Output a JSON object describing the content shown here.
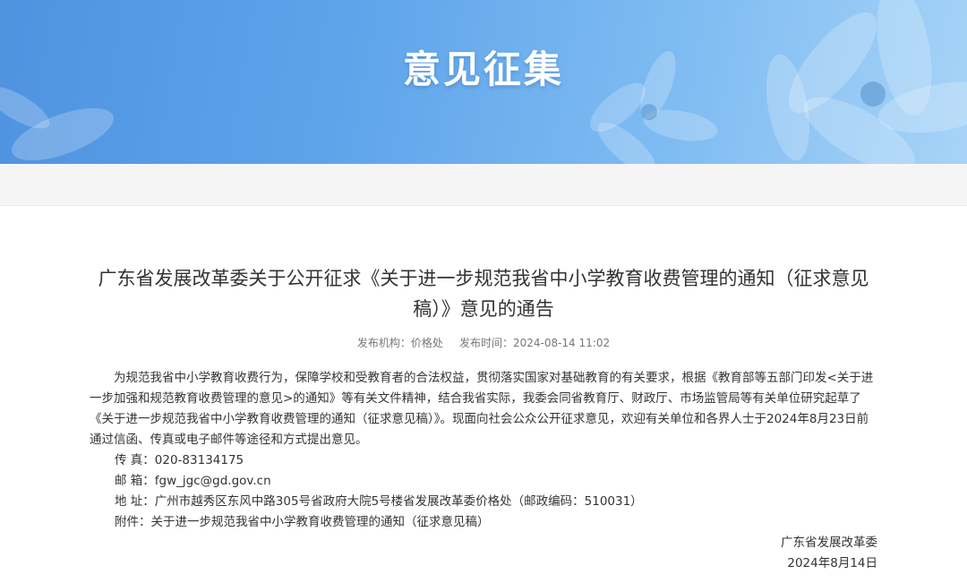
{
  "banner": {
    "title": "意见征集"
  },
  "article": {
    "title": "广东省发展改革委关于公开征求《关于进一步规范我省中小学教育收费管理的通知（征求意见稿）》意见的通告",
    "meta": {
      "publisher_label": "发布机构：",
      "publisher": "价格处",
      "time_label": "发布时间：",
      "time": "2024-08-14 11:02"
    },
    "paragraph": "为规范我省中小学教育收费行为，保障学校和受教育者的合法权益，贯彻落实国家对基础教育的有关要求，根据《教育部等五部门印发<关于进一步加强和规范教育收费管理的意见>的通知》等有关文件精神，结合我省实际，我委会同省教育厅、财政厅、市场监管局等有关单位研究起草了《关于进一步规范我省中小学教育收费管理的通知（征求意见稿）》。现面向社会公众公开征求意见，欢迎有关单位和各界人士于2024年8月23日前通过信函、传真或电子邮件等途径和方式提出意见。",
    "contacts": [
      {
        "label": "传 真：",
        "value": "020-83134175"
      },
      {
        "label": "邮 箱：",
        "value": "fgw_jgc@gd.gov.cn"
      },
      {
        "label": "地 址：",
        "value": "广州市越秀区东风中路305号省政府大院5号楼省发展改革委价格处（邮政编码：510031）"
      },
      {
        "label": "附件：",
        "value": "关于进一步规范我省中小学教育收费管理的通知（征求意见稿）"
      }
    ],
    "signature": {
      "org": "广东省发展改革委",
      "date": "2024年8月14日"
    }
  },
  "icons": [
    "flower-decoration-icon"
  ]
}
